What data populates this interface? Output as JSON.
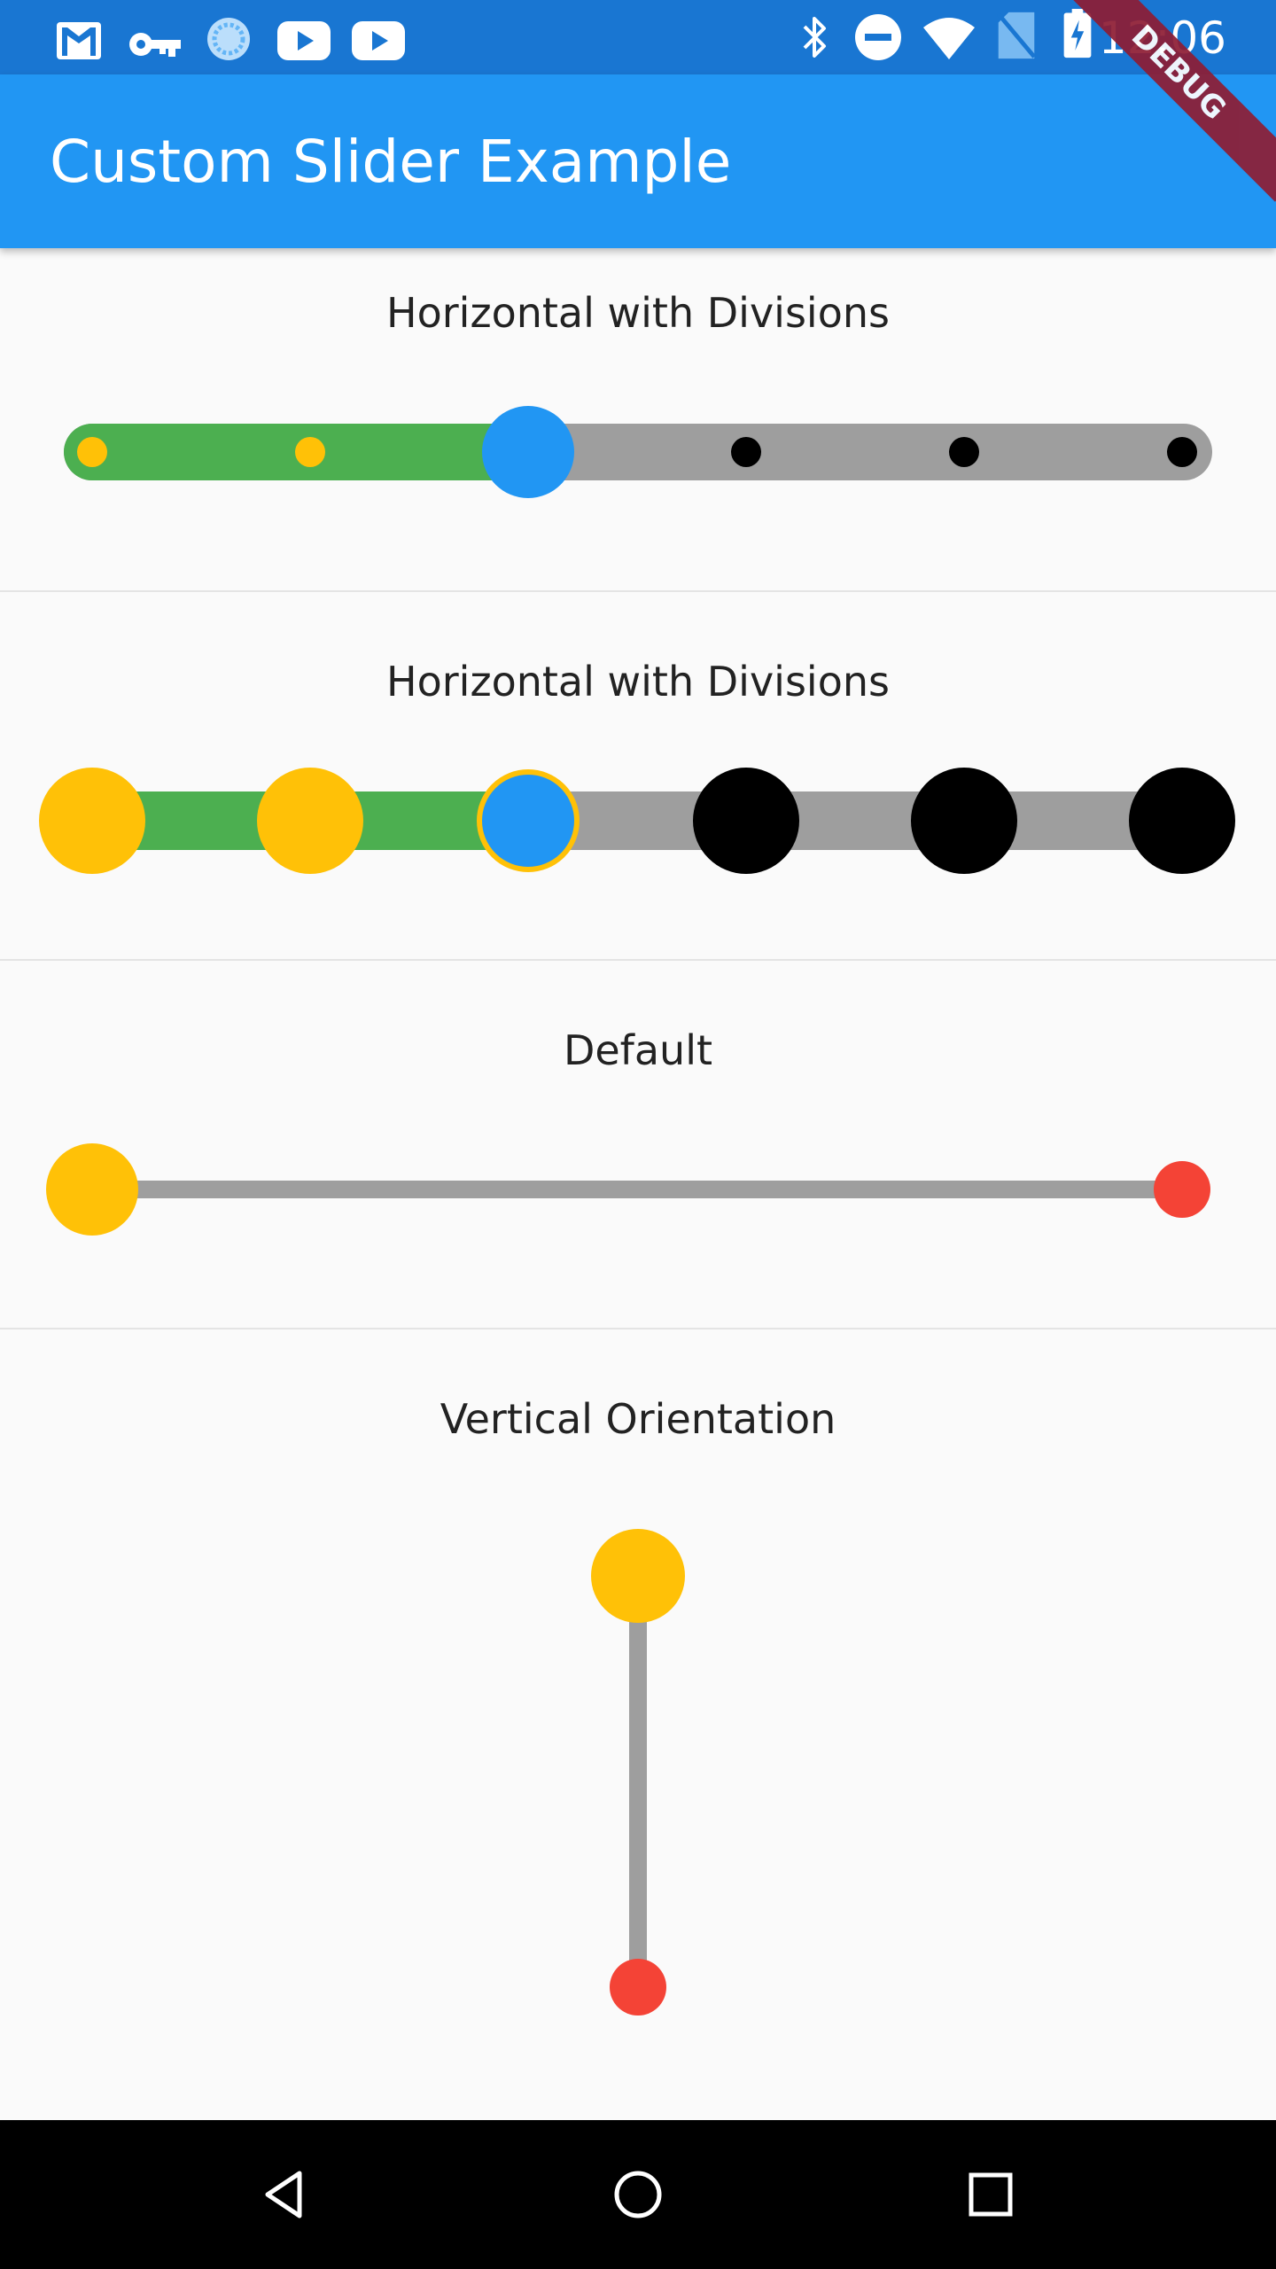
{
  "status_bar": {
    "time": "12:06",
    "left_icons": [
      "gmail-icon",
      "vpn-key-icon",
      "sync-icon",
      "youtube-icon",
      "youtube-icon"
    ],
    "right_icons": [
      "bluetooth-icon",
      "do-not-disturb-icon",
      "wifi-icon",
      "no-sim-icon",
      "battery-charging-icon"
    ]
  },
  "debug_banner": "DEBUG",
  "app_bar": {
    "title": "Custom Slider Example"
  },
  "sliders": [
    {
      "title": "Horizontal with Divisions",
      "style": "small-dots",
      "divisions": 5,
      "value_index": 2,
      "colors": {
        "active_track": "#4caf50",
        "inactive_track": "#9e9e9e",
        "active_tick": "#ffc107",
        "inactive_tick": "#000000",
        "thumb": "#2196f3"
      }
    },
    {
      "title": "Horizontal with Divisions",
      "style": "large-dots",
      "divisions": 5,
      "value_index": 2,
      "colors": {
        "active_track": "#4caf50",
        "inactive_track": "#9e9e9e",
        "active_tick": "#ffc107",
        "inactive_tick": "#000000",
        "thumb": "#2196f3",
        "thumb_border": "#ffc107"
      }
    },
    {
      "title": "Default",
      "value_fraction": 0.0,
      "colors": {
        "track": "#9e9e9e",
        "thumb": "#ffc107",
        "end_marker": "#f44336"
      }
    },
    {
      "title": "Vertical Orientation",
      "value_fraction": 1.0,
      "colors": {
        "track": "#9e9e9e",
        "thumb": "#ffc107",
        "end_marker": "#f44336"
      }
    }
  ],
  "nav_bar": {
    "icons": [
      "back-icon",
      "home-icon",
      "recents-icon"
    ]
  }
}
